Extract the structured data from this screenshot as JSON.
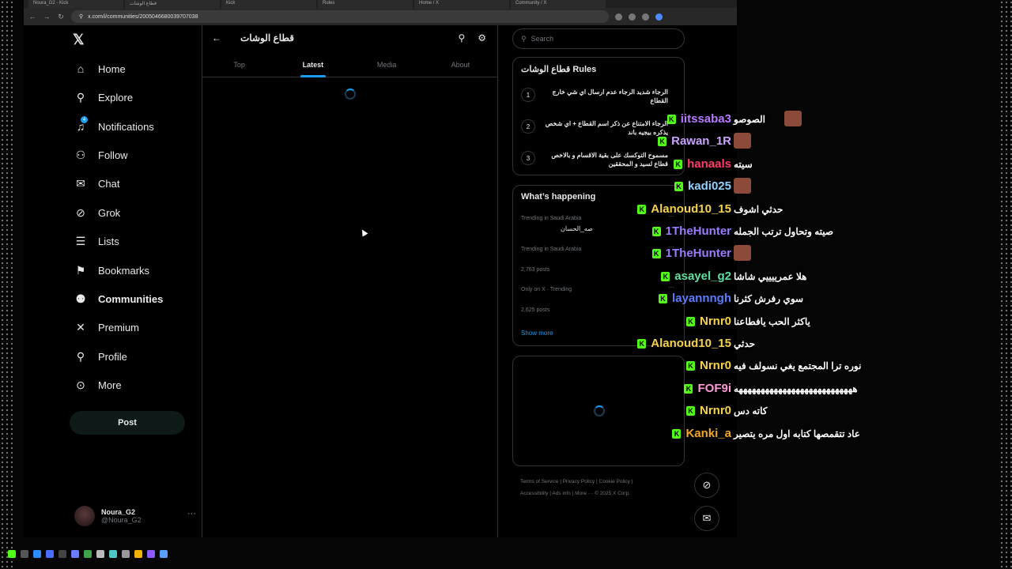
{
  "browser": {
    "tabs": [
      "Noura_G2 - Kick",
      "قطاع الوشات",
      "Kick",
      "Rules",
      "Home / X",
      "Community / X"
    ],
    "url": "x.com/i/communities/2005046680039707038"
  },
  "nav": {
    "items": [
      {
        "label": "Home",
        "icon": "home-icon"
      },
      {
        "label": "Explore",
        "icon": "search-icon"
      },
      {
        "label": "Notifications",
        "icon": "bell-icon",
        "badge": "4"
      },
      {
        "label": "Follow",
        "icon": "add-person-icon"
      },
      {
        "label": "Chat",
        "icon": "mail-icon"
      },
      {
        "label": "Grok",
        "icon": "grok-icon"
      },
      {
        "label": "Lists",
        "icon": "list-icon"
      },
      {
        "label": "Bookmarks",
        "icon": "bookmark-icon"
      },
      {
        "label": "Communities",
        "icon": "people-icon"
      },
      {
        "label": "Premium",
        "icon": "x-icon"
      },
      {
        "label": "Profile",
        "icon": "person-icon"
      },
      {
        "label": "More",
        "icon": "more-circle-icon"
      }
    ],
    "post_label": "Post",
    "account": {
      "name": "Noura_G2",
      "handle": "@Noura_G2"
    }
  },
  "main": {
    "title": "قطاع الوشات",
    "tabs": [
      "Top",
      "Latest",
      "Media",
      "About"
    ],
    "active_tab": "Latest"
  },
  "side": {
    "search_placeholder": "Search",
    "rules_title": "قطاع الوشات Rules",
    "rules": [
      {
        "num": "1",
        "text": "الرجاء شديد الرجاء عدم ارسال اي شي خارج القطاع"
      },
      {
        "num": "2",
        "text": "الرجاء الامتناع عن ذكر اسم القطاع + اي شخص يذكره بيجيه باند"
      },
      {
        "num": "3",
        "text": "مسموح التوكسك على بقية الاقسام و بالاخص قطاع لسيد و المحققين"
      }
    ],
    "happening_title": "What’s happening",
    "trends": [
      {
        "context": "Trending in Saudi Arabia",
        "name": "صه_الحسان",
        "more": "···"
      },
      {
        "context": "Trending in Saudi Arabia",
        "name": "",
        "more": "···"
      },
      {
        "context": "2,763 posts",
        "name": "",
        "more": ""
      },
      {
        "context": "Only on X · Trending",
        "name": "",
        "more": "···"
      },
      {
        "context": "2,625 posts",
        "name": "",
        "more": ""
      }
    ],
    "show_more": "Show more",
    "footer": [
      "Terms of Service",
      "Privacy Policy",
      "Cookie Policy",
      "Accessibility",
      "Ads info",
      "More ···",
      "© 2025 X Corp."
    ]
  },
  "chat": [
    {
      "user": "iitssaba3",
      "color": "#b57bff",
      "text": "الصوصو",
      "emote": true
    },
    {
      "user": "Rawan_1R",
      "color": "#c9a2ff",
      "text": "",
      "emote": true
    },
    {
      "user": "hanaals",
      "color": "#ff3b6b",
      "text": "سيته",
      "emote": false
    },
    {
      "user": "kadi025",
      "color": "#8fd1ff",
      "text": "",
      "emote": true
    },
    {
      "user": "Alanoud10_15",
      "color": "#f5d24a",
      "text": "حدثي اشوف",
      "emote": false
    },
    {
      "user": "1TheHunter",
      "color": "#9b7bff",
      "text": "صيته وتحاول ترتب الجمله",
      "emote": false
    },
    {
      "user": "1TheHunter",
      "color": "#9b7bff",
      "text": "",
      "emote": true
    },
    {
      "user": "asayel_g2",
      "color": "#5ee0a0",
      "text": "هلا عمرييييي شاشا",
      "emote": false
    },
    {
      "user": "layannngh",
      "color": "#5c7cff",
      "text": "سوي رفرش كثرنا",
      "emote": false
    },
    {
      "user": "Nrnr0",
      "color": "#f5d24a",
      "text": "ياكثر الحب يافطاعنا",
      "emote": false
    },
    {
      "user": "Alanoud10_15",
      "color": "#f5d24a",
      "text": "حدثي",
      "emote": false
    },
    {
      "user": "Nrnr0",
      "color": "#f5d24a",
      "text": "نوره ترا المجتمع يغي نسولف فيه",
      "emote": false
    },
    {
      "user": "FOF9i",
      "color": "#ff9ad5",
      "text": "هههههههههههههههههههههههههههه",
      "emote": false
    },
    {
      "user": "Nrnr0",
      "color": "#f5d24a",
      "text": "كاته دس",
      "emote": false
    },
    {
      "user": "Kanki_a",
      "color": "#f5a623",
      "text": "عاد تتقمصها كتابه اول مره يتصير",
      "emote": false
    }
  ],
  "colors": {
    "accent": "#1d9bf0",
    "kick_green": "#53fc18"
  }
}
